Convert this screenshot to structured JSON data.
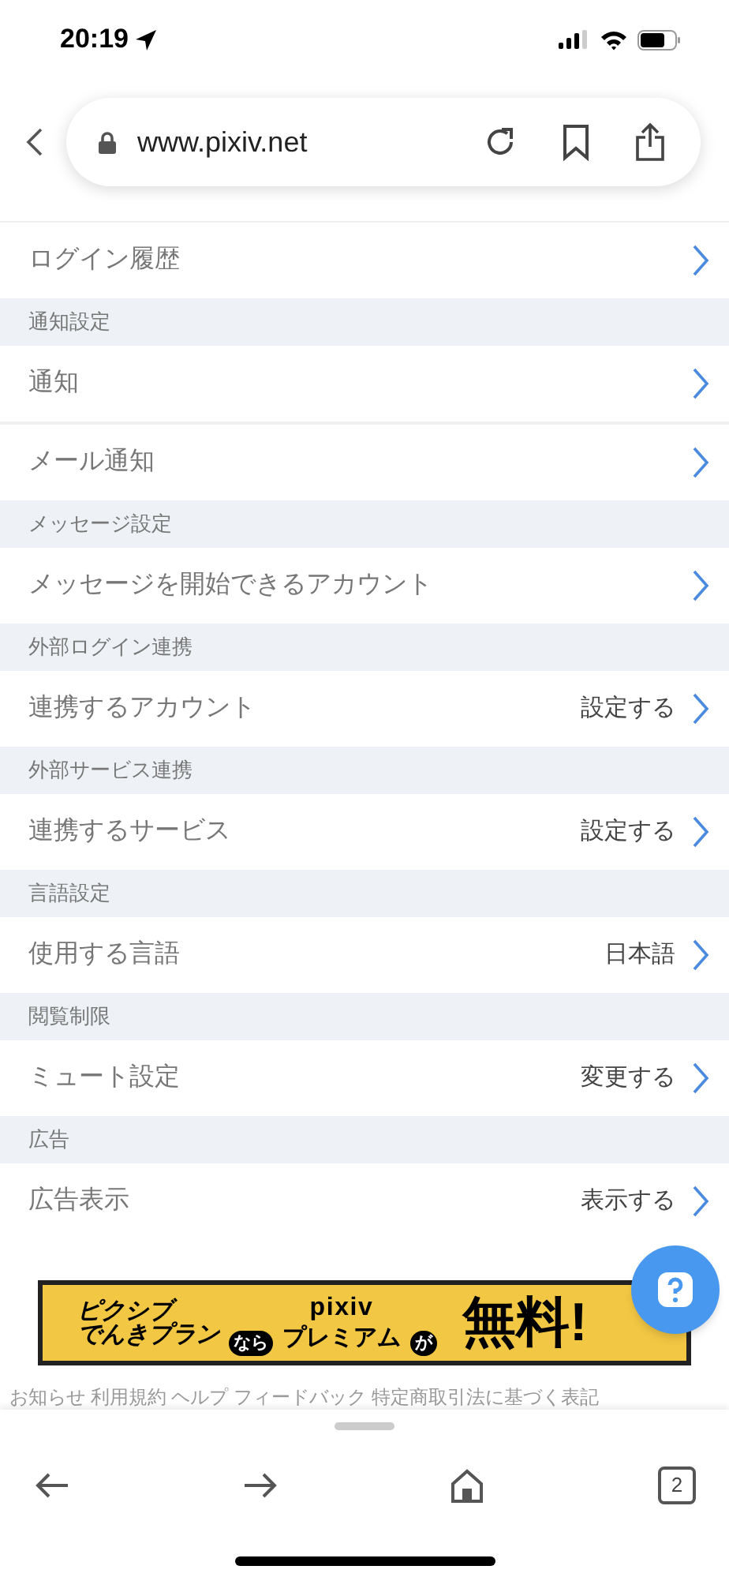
{
  "status_bar": {
    "time": "20:19"
  },
  "browser": {
    "url": "www.pixiv.net"
  },
  "settings": [
    {
      "kind": "row",
      "label": "ログイン履歴"
    },
    {
      "kind": "header",
      "label": "通知設定"
    },
    {
      "kind": "row",
      "label": "通知"
    },
    {
      "kind": "row",
      "label": "メール通知"
    },
    {
      "kind": "header",
      "label": "メッセージ設定"
    },
    {
      "kind": "row",
      "label": "メッセージを開始できるアカウント"
    },
    {
      "kind": "header",
      "label": "外部ログイン連携"
    },
    {
      "kind": "row",
      "label": "連携するアカウント",
      "value": "設定する"
    },
    {
      "kind": "header",
      "label": "外部サービス連携"
    },
    {
      "kind": "row",
      "label": "連携するサービス",
      "value": "設定する"
    },
    {
      "kind": "header",
      "label": "言語設定"
    },
    {
      "kind": "row",
      "label": "使用する言語",
      "value": "日本語"
    },
    {
      "kind": "header",
      "label": "閲覧制限"
    },
    {
      "kind": "row",
      "label": "ミュート設定",
      "value": "変更する"
    },
    {
      "kind": "header",
      "label": "広告"
    },
    {
      "kind": "row",
      "label": "広告表示",
      "value": "表示する"
    }
  ],
  "banner": {
    "line_1": "ピクシブ",
    "line_2": "でんきプラン",
    "badge_1": "なら",
    "brand": "pixiv",
    "product": "プレミアム",
    "badge_2": "が",
    "headline": "無料!"
  },
  "footer_links": "お知らせ 利用規約 ヘルプ フィードバック 特定商取引法に基づく表記",
  "toolbar": {
    "tab_count": "2"
  }
}
